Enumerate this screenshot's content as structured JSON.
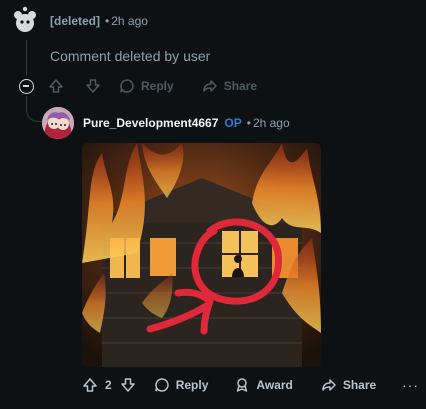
{
  "comment_deleted": {
    "author": "[deleted]",
    "time": "2h ago",
    "body": "Comment deleted by user",
    "reply_label": "Reply",
    "share_label": "Share"
  },
  "comment_op": {
    "author": "Pure_Development4667",
    "op_badge": "OP",
    "time": "2h ago",
    "vote_count": "2",
    "reply_label": "Reply",
    "award_label": "Award",
    "share_label": "Share",
    "more_label": "···"
  },
  "colors": {
    "background": "#0e1113",
    "muted_text": "#8ba2ad",
    "op_badge": "#2f7dd8",
    "fire": "#e8762a",
    "annotation": "#e0283b"
  }
}
